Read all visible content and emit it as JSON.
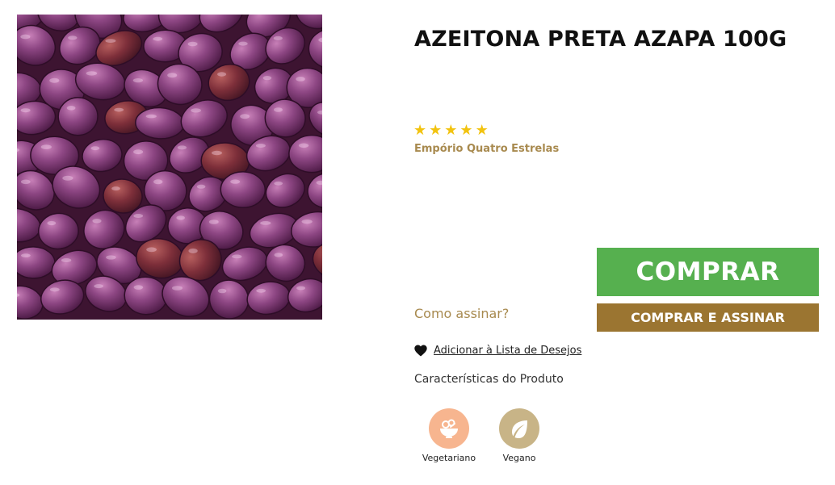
{
  "product": {
    "title": "AZEITONA PRETA AZAPA 100G",
    "image_alt": "Azeitonas pretas azapa",
    "rating": 5,
    "rating_max": 5,
    "brand": "Empório Quatro Estrelas"
  },
  "actions": {
    "buy_label": "COMPRAR",
    "buy_subscribe_label": "COMPRAR E ASSINAR",
    "how_subscribe_label": "Como assinar?",
    "wishlist_label": "Adicionar à Lista de Desejos"
  },
  "features": {
    "heading": "Características do Produto",
    "items": [
      {
        "label": "Vegetariano",
        "icon": "salad-bowl-icon",
        "color": "#f7b58f"
      },
      {
        "label": "Vegano",
        "icon": "leaf-icon",
        "color": "#c8b487"
      }
    ]
  },
  "colors": {
    "buy_button": "#56b04f",
    "subscribe_button": "#9b7531",
    "brand_text": "#a88a4f",
    "stars": "#f2c30f"
  }
}
